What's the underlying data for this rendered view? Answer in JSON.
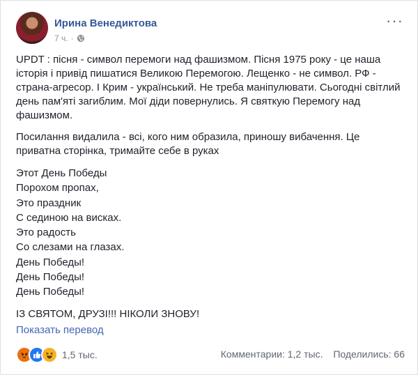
{
  "post": {
    "author": "Ирина Венедиктова",
    "time": "7 ч.",
    "paragraphs": [
      "UPDT : пісня - символ перемоги над фашизмом. Пісня 1975 року - це наша історія і привід пишатися Великою Перемогою. Лещенко - не символ. РФ - страна-агресор. І Крим - український. Не треба маніпулювати. Сьогодні світлий день пам'яті загиблим. Мої діди повернулись. Я святкую Перемогу над фашизмом.",
      "Посилання видалила - всі, кого ним образила, приношу вибачення. Це приватна сторінка, тримайте себе в руках"
    ],
    "poem": [
      "Этот День Победы",
      "Порохом пропах,",
      "Это праздник",
      "С сединою на висках.",
      "Это радость",
      "Со слезами на глазах.",
      "День Победы!",
      "День Победы!",
      "День Победы!"
    ],
    "closing": "ІЗ СВЯТОМ, ДРУЗІ!!! НІКОЛИ ЗНОВУ!",
    "translate_link": "Показать перевод"
  },
  "footer": {
    "reactions": [
      "angry",
      "like",
      "haha"
    ],
    "reaction_count": "1,5 тыс.",
    "comments": "Комментарии: 1,2 тыс.",
    "shares": "Поделились: 66"
  },
  "colors": {
    "link": "#365899",
    "text": "#1d2129",
    "meta": "#90949c"
  }
}
